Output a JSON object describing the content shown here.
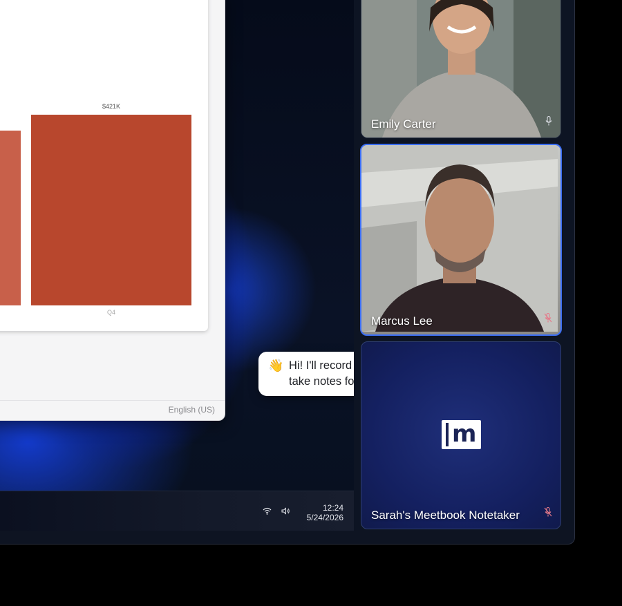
{
  "document": {
    "chart_data": {
      "type": "bar",
      "categories": [
        "",
        "Q4"
      ],
      "values": [
        null,
        421
      ],
      "data_labels": [
        "",
        "$421K"
      ],
      "colors": [
        "#c8604a",
        "#b8472d"
      ]
    },
    "status_language": "English (US)"
  },
  "taskbar": {
    "time": "12:24",
    "date": "5/24/2026",
    "icons": [
      "wifi-icon",
      "speaker-icon"
    ]
  },
  "participants": [
    {
      "name": "Emily Carter",
      "mic": "mic-on-icon",
      "active": false
    },
    {
      "name": "Marcus Lee",
      "mic": "mic-muted-icon",
      "active": true
    },
    {
      "name": "Sarah's Meetbook Notetaker",
      "mic": "mic-muted-icon",
      "active": false,
      "logo": "meetbook-logo"
    }
  ],
  "bubble": {
    "emoji": "👋",
    "line1": "Hi! I'll record &",
    "line2": "take notes for Sarah."
  },
  "colors": {
    "active_border": "#3b6ef5",
    "bar_primary": "#b8472d"
  }
}
